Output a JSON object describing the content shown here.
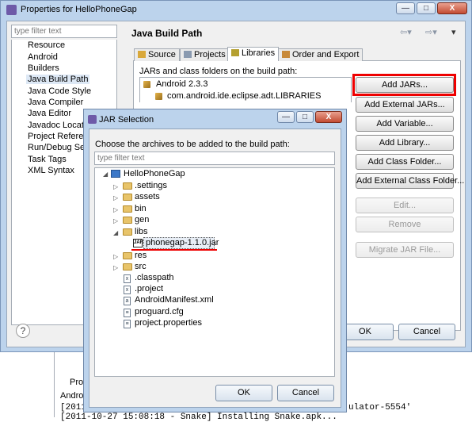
{
  "window": {
    "title": "Properties for HelloPhoneGap",
    "btn_min": "—",
    "btn_max": "□",
    "btn_close": "X"
  },
  "nav": {
    "filter_placeholder": "type filter text",
    "items": [
      "Resource",
      "Android",
      "Builders",
      "Java Build Path",
      "Java Code Style",
      "Java Compiler",
      "Java Editor",
      "Javadoc Location",
      "Project References",
      "Run/Debug Settings",
      "Task Tags",
      "XML Syntax"
    ],
    "selected_index": 3
  },
  "panel": {
    "title": "Java Build Path",
    "tabs": [
      "Source",
      "Projects",
      "Libraries",
      "Order and Export"
    ],
    "active_tab": "Libraries",
    "jars_label": "JARs and class folders on the build path:",
    "libraries": [
      "Android 2.3.3",
      "com.android.ide.eclipse.adt.LIBRARIES"
    ],
    "buttons": [
      "Add JARs...",
      "Add External JARs...",
      "Add Variable...",
      "Add Library...",
      "Add Class Folder...",
      "Add External Class Folder...",
      "Edit...",
      "Remove",
      "Migrate JAR File..."
    ]
  },
  "footer": {
    "help": "?",
    "ok": "OK",
    "cancel": "Cancel"
  },
  "console": {
    "tab": "Pro",
    "line1": "Android",
    "line2": "[2011",
    "line3": "[2011-10-27 15:08:18 - Snake] Installing Snake.apk...",
    "tail": "ulator-5554'"
  },
  "dialog": {
    "title": "JAR Selection",
    "prompt": "Choose the archives to be added to the build path:",
    "filter_placeholder": "type filter text",
    "tree": {
      "root": "HelloPhoneGap",
      "children": [
        ".settings",
        "assets",
        "bin",
        "gen",
        "libs",
        "res",
        "src"
      ],
      "jar": "phonegap-1.1.0.jar",
      "files": [
        ".classpath",
        ".project",
        "AndroidManifest.xml",
        "proguard.cfg",
        "project.properties"
      ]
    },
    "ok": "OK",
    "cancel": "Cancel"
  },
  "colors": {
    "accent_red": "#e00000",
    "titlebar": "#bcd3ec",
    "folder": "#e8c46a"
  }
}
